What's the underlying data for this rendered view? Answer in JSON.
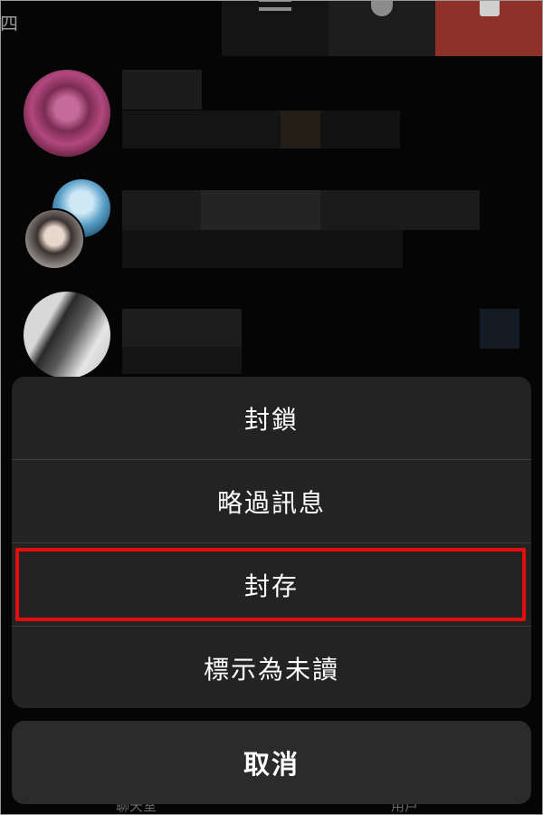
{
  "header": {
    "corner_char": "四"
  },
  "swipe_actions": [
    {
      "icon": "more-lines-icon"
    },
    {
      "icon": "bell-icon"
    },
    {
      "icon": "trash-icon",
      "color": "#8e3129"
    }
  ],
  "action_sheet": {
    "items": [
      {
        "label": "封鎖"
      },
      {
        "label": "略過訊息"
      },
      {
        "label": "封存",
        "highlighted": true
      },
      {
        "label": "標示為未讀"
      }
    ],
    "cancel_label": "取消",
    "highlight_color": "#e30d0d"
  },
  "tab_bar": {
    "left_label": "聊天室",
    "right_label": "用戶"
  }
}
